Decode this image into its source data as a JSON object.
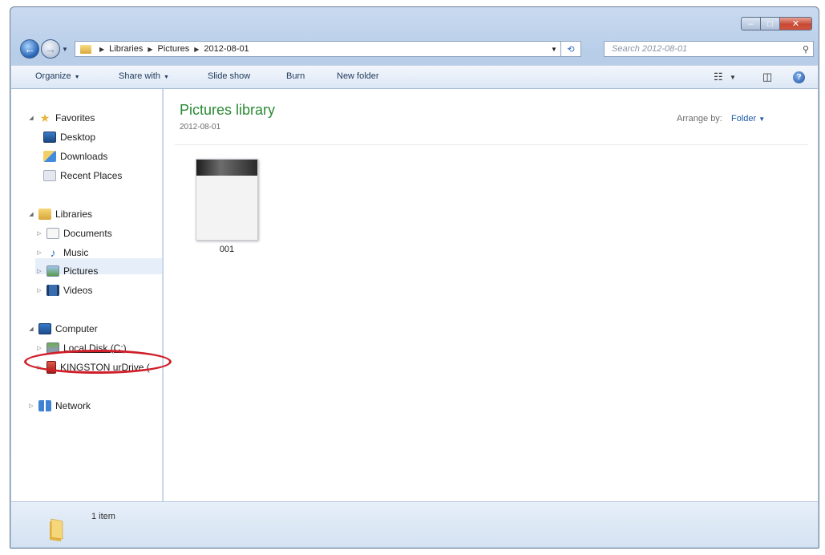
{
  "window": {
    "minimize_glyph": "–",
    "maximize_glyph": "□",
    "close_glyph": "✕"
  },
  "address_bar": {
    "breadcrumbs": [
      "Libraries",
      "Pictures",
      "2012-08-01"
    ]
  },
  "search": {
    "placeholder": "Search 2012-08-01"
  },
  "toolbar": {
    "organize": "Organize",
    "share_with": "Share with",
    "slide_show": "Slide show",
    "burn": "Burn",
    "new_folder": "New folder"
  },
  "nav": {
    "favorites": "Favorites",
    "desktop": "Desktop",
    "downloads": "Downloads",
    "recent_places": "Recent Places",
    "libraries": "Libraries",
    "documents": "Documents",
    "music": "Music",
    "pictures": "Pictures",
    "videos": "Videos",
    "computer": "Computer",
    "local_disk": "Local Disk (C:)",
    "kingston": "KINGSTON urDrive (",
    "network": "Network"
  },
  "content": {
    "title": "Pictures library",
    "subtitle": "2012-08-01",
    "arrange_label": "Arrange by:",
    "arrange_value": "Folder"
  },
  "files": [
    {
      "name": "001"
    }
  ],
  "status": {
    "item_count": "1 item"
  },
  "colors": {
    "library_title": "#2a8a34",
    "annotation_circle": "#d11f2a",
    "link_blue": "#1e5aa8"
  }
}
